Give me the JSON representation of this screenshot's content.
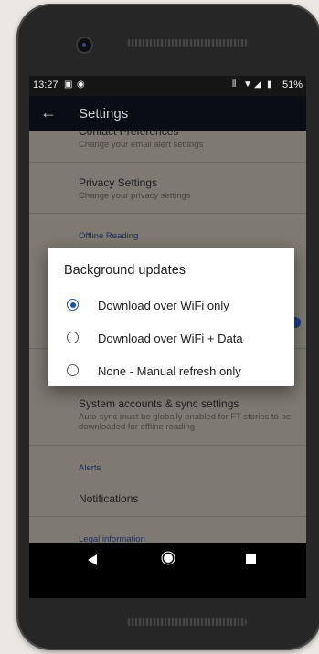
{
  "status_bar": {
    "time": "13:27",
    "icon_1": "image-icon",
    "icon_2": "notification-icon",
    "signal_icons": "vibrate wifi cell",
    "battery": "51%"
  },
  "app_bar": {
    "back_icon": "arrow-left-icon",
    "title": "Settings"
  },
  "settings_list": {
    "contact_title": "Contact Preferences",
    "contact_sub": "Change your email alert settings",
    "privacy_title": "Privacy Settings",
    "privacy_sub": "Change your privacy settings",
    "offline_header": "Offline Reading",
    "sync_title": "System accounts & sync settings",
    "sync_sub": "Auto-sync must be globally enabled for FT stories to be downloaded for offline reading",
    "alerts_header": "Alerts",
    "notifications_title": "Notifications",
    "legal_header": "Legal information"
  },
  "dialog": {
    "title": "Background updates",
    "options": [
      {
        "label": "Download over WiFi only",
        "selected": true
      },
      {
        "label": "Download over WiFi + Data",
        "selected": false
      },
      {
        "label": "None - Manual refresh only",
        "selected": false
      }
    ]
  },
  "nav_bar": {
    "back": "nav-back-icon",
    "home": "nav-home-icon",
    "recents": "nav-recents-icon"
  },
  "colors": {
    "accent": "#1f4e9e",
    "scrim_content": "#7e7972",
    "app_bar": "#0b0d14"
  }
}
